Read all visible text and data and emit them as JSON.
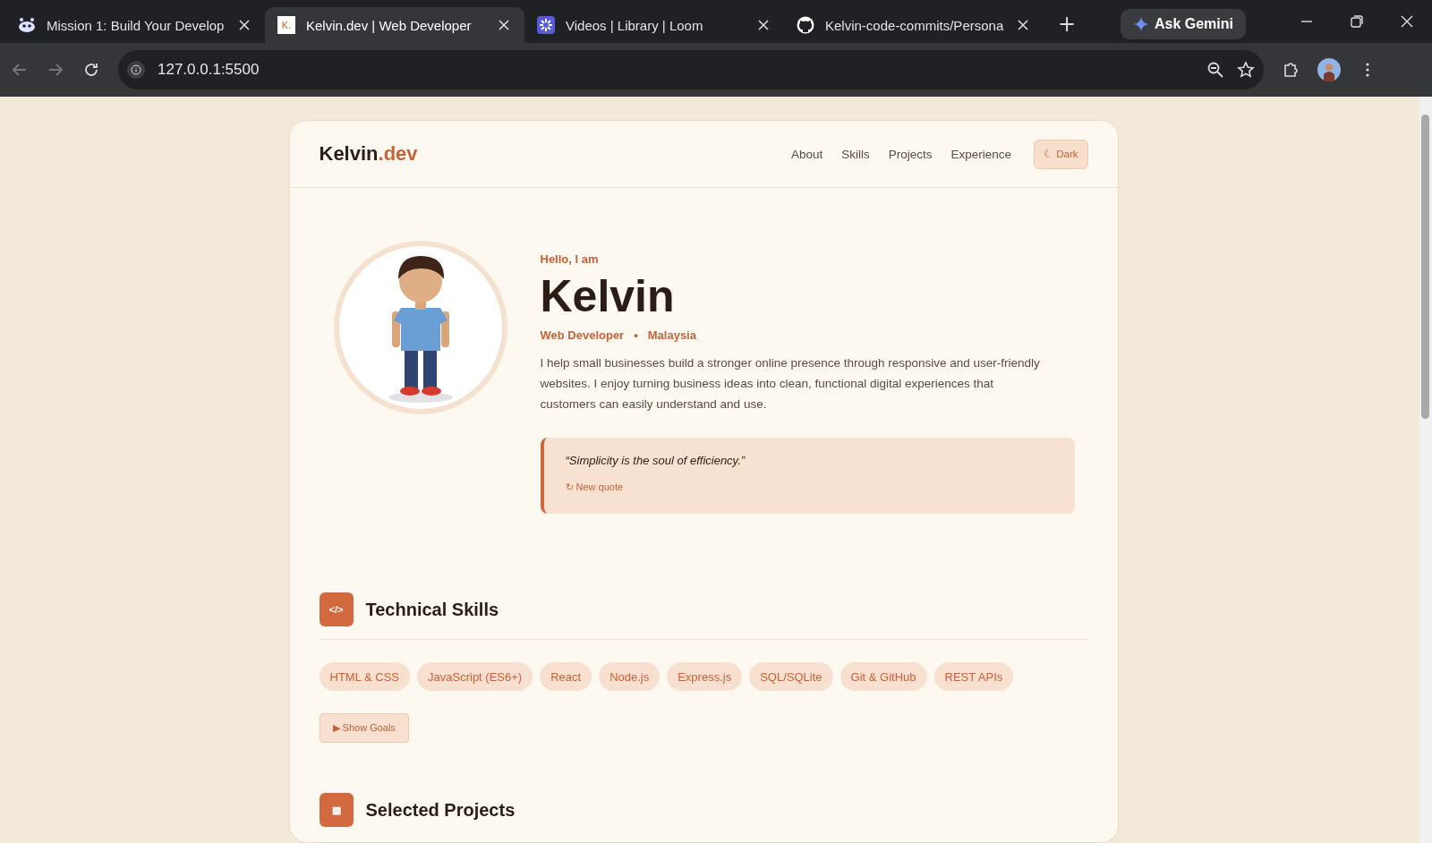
{
  "browser": {
    "tabs": [
      {
        "title": "Mission 1: Build Your Develop",
        "kind": "robot",
        "selected": false
      },
      {
        "title": "Kelvin.dev | Web Developer",
        "kind": "letter",
        "favicon_text": "K.",
        "selected": true
      },
      {
        "title": "Videos | Library | Loom",
        "kind": "loom",
        "selected": false
      },
      {
        "title": "Kelvin-code-commits/Persona",
        "kind": "github",
        "selected": false
      }
    ],
    "new_tab": "+",
    "gemini": "Ask Gemini",
    "address": "127.0.0.1:5500"
  },
  "site": {
    "logo_main": "Kelvin",
    "logo_accent": ".dev",
    "nav": [
      "About",
      "Skills",
      "Projects",
      "Experience"
    ],
    "theme_toggle": "☾ Dark",
    "hero": {
      "greeting": "Hello, I am",
      "name": "Kelvin",
      "role": "Web Developer",
      "separator": "•",
      "location": "Malaysia",
      "bio": "I help small businesses build a stronger online presence through responsive and user-friendly websites. I enjoy turning business ideas into clean, functional digital experiences that customers can easily understand and use.",
      "quote": "“Simplicity is the soul of efficiency.”",
      "quote_button": "↻ New quote"
    },
    "sections": [
      {
        "icon": "</>",
        "title": "Technical Skills",
        "chips": [
          "HTML & CSS",
          "JavaScript (ES6+)",
          "React",
          "Node.js",
          "Express.js",
          "SQL/SQLite",
          "Git & GitHub",
          "REST APIs"
        ],
        "toggle": "▶ Show Goals"
      },
      {
        "icon": "▦",
        "title": "Selected Projects"
      }
    ]
  }
}
